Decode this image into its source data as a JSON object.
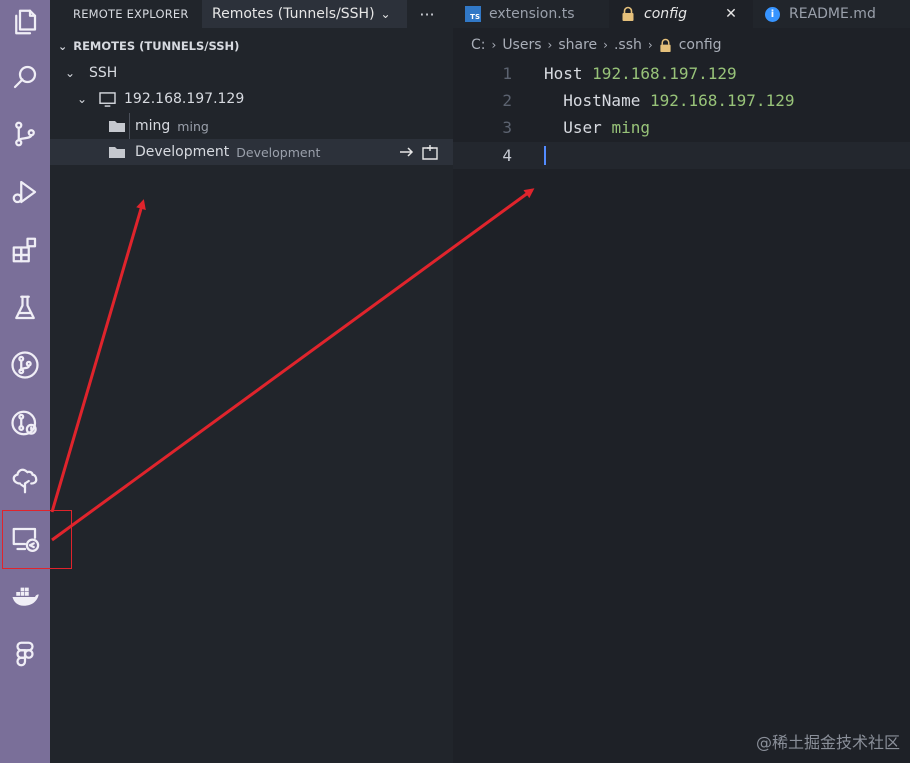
{
  "activity_bar": {
    "icons": [
      "explorer-icon",
      "search-icon",
      "source-control-icon",
      "run-debug-icon",
      "extensions-icon",
      "testing-icon",
      "git-graph-icon",
      "git-history-icon",
      "tree-icon",
      "remote-explorer-icon",
      "docker-icon",
      "figma-icon"
    ],
    "highlight_color": "#e0242c"
  },
  "sidebar": {
    "title": "REMOTE EXPLORER",
    "dropdown_value": "Remotes (Tunnels/SSH)",
    "more_actions": "···",
    "section_title": "REMOTES (TUNNELS/SSH)",
    "tree": {
      "group": "SSH",
      "host": "192.168.197.129",
      "folders": [
        {
          "name": "ming",
          "desc": "ming"
        },
        {
          "name": "Development",
          "desc": "Development"
        }
      ]
    }
  },
  "tabs": [
    {
      "label": "extension.ts",
      "icon": "typescript-icon"
    },
    {
      "label": "config",
      "icon": "lock-icon",
      "active": true
    },
    {
      "label": "README.md",
      "icon": "info-icon"
    }
  ],
  "breadcrumb": [
    "C:",
    "Users",
    "share",
    ".ssh",
    "config"
  ],
  "code": {
    "line_numbers": [
      "1",
      "2",
      "3",
      "4"
    ],
    "lines": [
      {
        "key": "Host",
        "value": "192.168.197.129",
        "indent": ""
      },
      {
        "key": "HostName",
        "value": "192.168.197.129",
        "indent": "  "
      },
      {
        "key": "User",
        "value": "ming",
        "indent": "  "
      },
      {
        "key": "",
        "value": "",
        "indent": ""
      }
    ],
    "value_color": "#98c379"
  },
  "watermark": "@稀土掘金技术社区"
}
